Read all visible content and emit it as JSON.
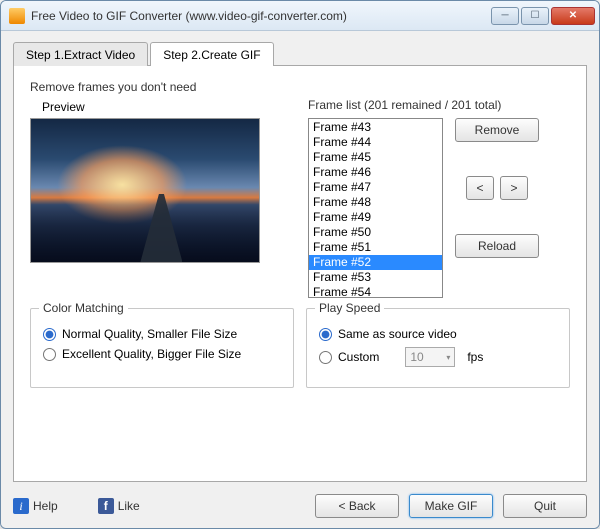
{
  "window": {
    "title": "Free Video to GIF Converter (www.video-gif-converter.com)"
  },
  "tabs": {
    "step1": "Step 1.Extract Video",
    "step2": "Step 2.Create GIF"
  },
  "frames": {
    "section_title": "Remove frames you don't need",
    "preview_label": "Preview",
    "list_label": "Frame list (201 remained / 201 total)",
    "items": [
      "Frame #43",
      "Frame #44",
      "Frame #45",
      "Frame #46",
      "Frame #47",
      "Frame #48",
      "Frame #49",
      "Frame #50",
      "Frame #51",
      "Frame #52",
      "Frame #53",
      "Frame #54"
    ],
    "selected_index": 9,
    "remove": "Remove",
    "prev": "<",
    "next": ">",
    "reload": "Reload"
  },
  "color": {
    "group": "Color Matching",
    "normal": "Normal Quality, Smaller File Size",
    "excellent": "Excellent Quality, Bigger File Size"
  },
  "speed": {
    "group": "Play Speed",
    "same": "Same as source video",
    "custom": "Custom",
    "fps_value": "10",
    "fps_unit": "fps"
  },
  "bottom": {
    "help": "Help",
    "like": "Like",
    "back": "< Back",
    "make": "Make GIF",
    "quit": "Quit"
  }
}
